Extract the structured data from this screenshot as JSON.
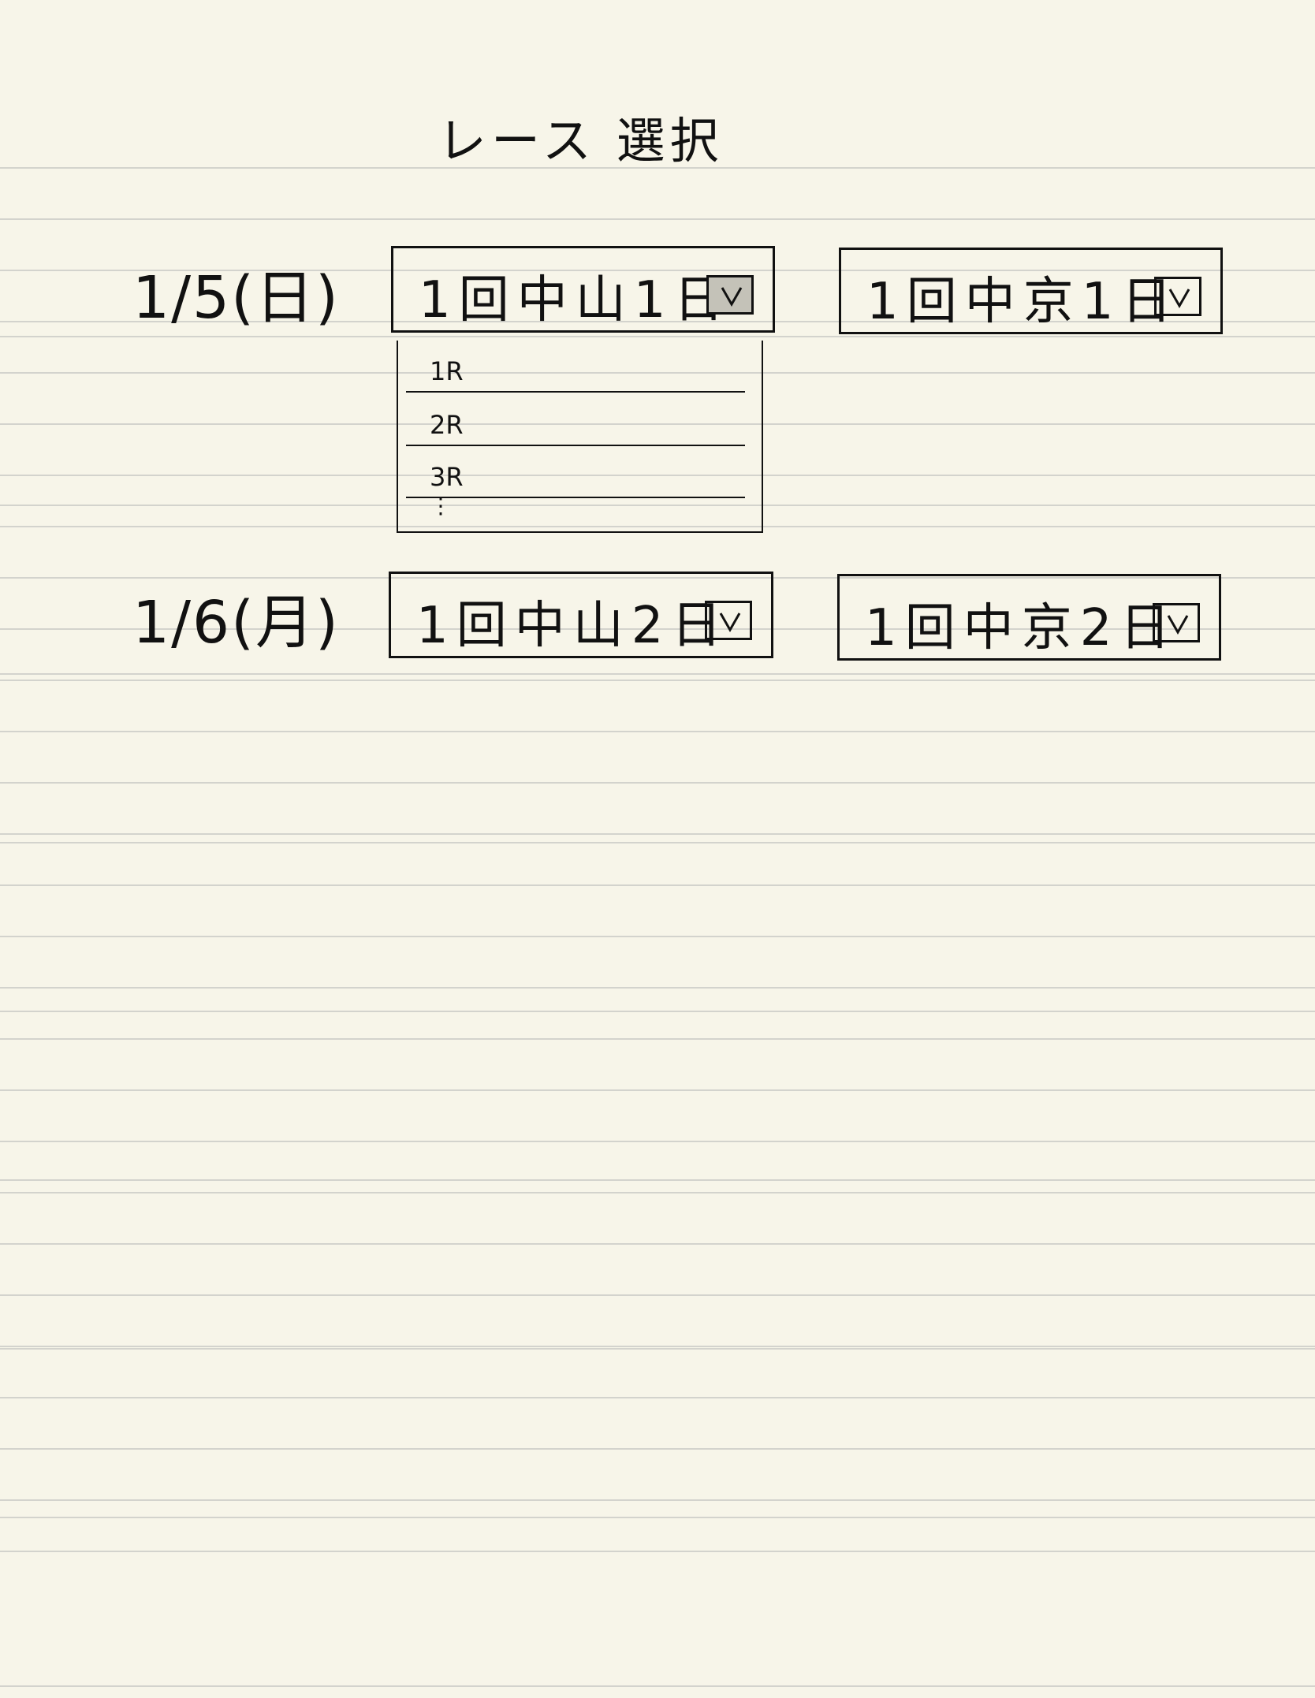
{
  "page": {
    "title": "レース 選択"
  },
  "days": [
    {
      "date_label": "1/5(日)",
      "meetings": [
        {
          "label": "1回中山1日",
          "arrow": "v",
          "icon": "chevron-down-icon",
          "state": "open"
        },
        {
          "label": "1回中京1日",
          "arrow": "v",
          "icon": "chevron-down-icon",
          "state": "closed"
        }
      ]
    },
    {
      "date_label": "1/6(月)",
      "meetings": [
        {
          "label": "1回中山2日",
          "arrow": "v",
          "icon": "chevron-down-icon",
          "state": "closed"
        },
        {
          "label": "1回中京2日",
          "arrow": "v",
          "icon": "chevron-down-icon",
          "state": "closed"
        }
      ]
    }
  ],
  "dropdown": {
    "options": [
      "1R",
      "2R",
      "3R"
    ],
    "more": "⋮"
  },
  "colors": {
    "paper": "#f7f5e9",
    "rule": "#d3d3cd",
    "ink": "#111111",
    "active_button": "#c4c2b8"
  }
}
